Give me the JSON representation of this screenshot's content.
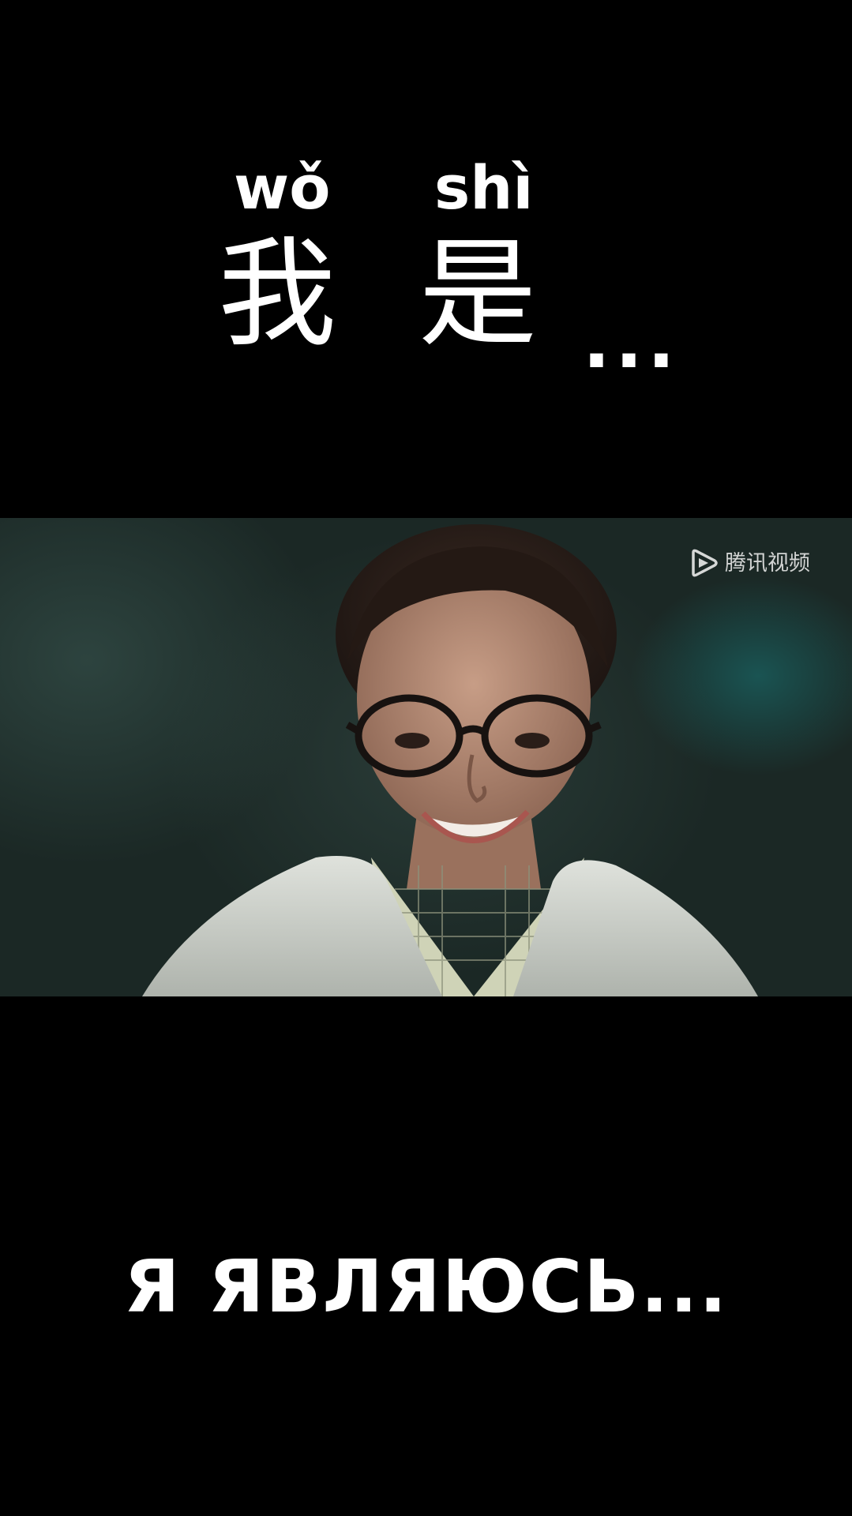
{
  "top_caption": {
    "pinyin": [
      "wǒ",
      "shì"
    ],
    "hanzi": [
      "我",
      "是"
    ],
    "ellipsis": "..."
  },
  "video": {
    "watermark_text": "腾讯视频",
    "watermark_icon": "tencent-video-logo-icon"
  },
  "bottom_caption": "Я ЯВЛЯЮСЬ...",
  "colors": {
    "background": "#000000",
    "text": "#ffffff",
    "scene_teal": "#1a2623"
  }
}
